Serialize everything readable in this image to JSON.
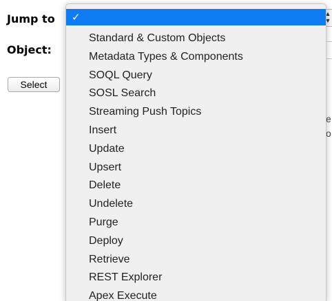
{
  "form": {
    "jump_label": "Jump to",
    "object_label": "Object:",
    "select_button": "Select"
  },
  "background": {
    "text_1": "e",
    "text_2": "o"
  },
  "dropdown": {
    "selected_item": "",
    "items": [
      "Standard & Custom Objects",
      "Metadata Types & Components",
      "SOQL Query",
      "SOSL Search",
      "Streaming Push Topics",
      "Insert",
      "Update",
      "Upsert",
      "Delete",
      "Undelete",
      "Purge",
      "Deploy",
      "Retrieve",
      "REST Explorer",
      "Apex Execute"
    ]
  },
  "colors": {
    "highlight": "#0f7bf5",
    "menu_background": "#f0f0f0"
  }
}
